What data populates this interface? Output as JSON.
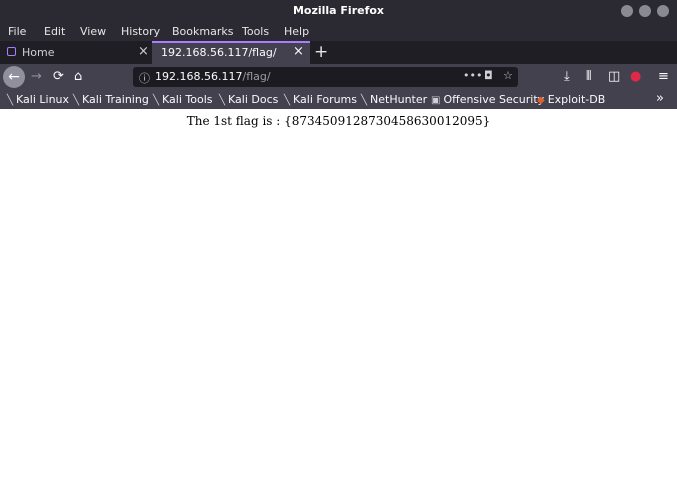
{
  "window": {
    "title": "Mozilla Firefox"
  },
  "menu": {
    "items": [
      {
        "label": "File"
      },
      {
        "label": "Edit"
      },
      {
        "label": "View"
      },
      {
        "label": "History"
      },
      {
        "label": "Bookmarks"
      },
      {
        "label": "Tools"
      },
      {
        "label": "Help"
      }
    ]
  },
  "tabs": [
    {
      "label": "Home",
      "active": false
    },
    {
      "label": "192.168.56.117/flag/",
      "active": true
    }
  ],
  "url": {
    "host": "192.168.56.117",
    "path": "/flag/"
  },
  "bookmarks": [
    {
      "label": "Kali Linux",
      "icon": "kali-icon"
    },
    {
      "label": "Kali Training",
      "icon": "kali-icon"
    },
    {
      "label": "Kali Tools",
      "icon": "kali-icon"
    },
    {
      "label": "Kali Docs",
      "icon": "kali-icon"
    },
    {
      "label": "Kali Forums",
      "icon": "kali-icon"
    },
    {
      "label": "NetHunter",
      "icon": "kali-icon"
    },
    {
      "label": "Offensive Security",
      "icon": "offsec-icon"
    },
    {
      "label": "Exploit-DB",
      "icon": "exploitdb-icon"
    }
  ],
  "page": {
    "text": "The 1st flag is : {8734509128730458630012095}"
  },
  "colors": {
    "accent": "#a97dff",
    "chrome": "#42414d",
    "titlebar": "#2b2a33"
  }
}
